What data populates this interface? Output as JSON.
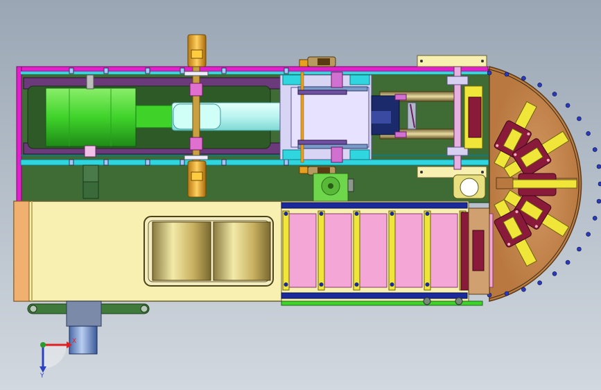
{
  "viewport": {
    "background_top": "#9aa6b4",
    "background_bottom": "#d2d8df"
  },
  "colors": {
    "frame_magenta": "#e020c8",
    "base_green": "#3f6b34",
    "cyan_rail": "#2fd6e0",
    "motor_green": "#3fd32a",
    "belt_cyan": "#b8f4f0",
    "housing_cream": "#f7f0b0",
    "carrier_pink": "#f4a6d6",
    "roller_yellow": "#f0e63a",
    "disc_brown": "#c68a55",
    "rim_blue": "#2a3ab8",
    "holder_maroon": "#8a1a3a",
    "gear_orange": "#e8a020",
    "lavender_block": "#d8d4f4",
    "stepper_green": "#6ed64a",
    "steel_blue": "#7a9ac8",
    "tan": "#9a8a5a"
  },
  "triad": {
    "x_label": "X",
    "y_label": "Y",
    "x_color": "#e02020",
    "y_color": "#2a9a2a",
    "z_color": "#2a40c0"
  },
  "icons": {
    "triad": "axis-triad-icon"
  }
}
